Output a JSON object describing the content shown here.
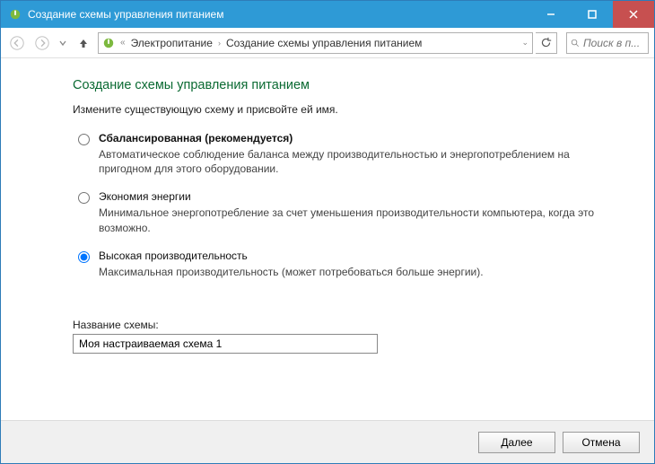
{
  "window": {
    "title": "Создание схемы управления питанием"
  },
  "breadcrumb": {
    "prefix": "«",
    "item1": "Электропитание",
    "item2": "Создание схемы управления питанием"
  },
  "search": {
    "placeholder": "Поиск в п..."
  },
  "page": {
    "heading": "Создание схемы управления питанием",
    "subheading": "Измените существующую схему и присвойте ей имя."
  },
  "plans": [
    {
      "name": "Сбалансированная (рекомендуется)",
      "desc": "Автоматическое соблюдение баланса между производительностью и энергопотреблением на пригодном для этого оборудовании.",
      "bold": true,
      "selected": false
    },
    {
      "name": "Экономия энергии",
      "desc": "Минимальное энергопотребление за счет уменьшения производительности компьютера, когда это возможно.",
      "bold": false,
      "selected": false
    },
    {
      "name": "Высокая производительность",
      "desc": "Максимальная производительность (может потребоваться больше энергии).",
      "bold": false,
      "selected": true
    }
  ],
  "scheme_name": {
    "label": "Название схемы:",
    "value": "Моя настраиваемая схема 1"
  },
  "buttons": {
    "next": "Далее",
    "cancel": "Отмена"
  }
}
